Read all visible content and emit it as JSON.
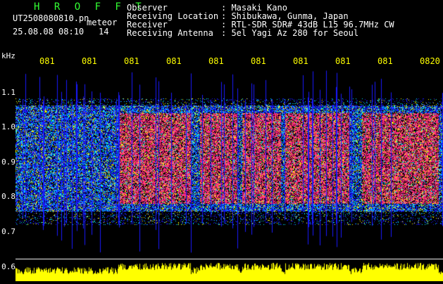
{
  "header": {
    "brand": "H R O F F T",
    "file_name": "UT2508080810.pn",
    "file_suffix": "meteor",
    "datetime": "25.08.08 08:10",
    "count": "14"
  },
  "station": {
    "rows": [
      {
        "label": "Observer",
        "value": ": Masaki Kano"
      },
      {
        "label": "Receiving Location",
        "value": ": Shibukawa, Gunma, Japan"
      },
      {
        "label": "Receiver",
        "value": ": RTL-SDR SDR# 43dB L15 96.7MHz CW"
      },
      {
        "label": "Receiving Antenna",
        "value": ": 5el Yagi Az 280 for Seoul"
      }
    ]
  },
  "spectrogram": {
    "unit": "kHz",
    "y_ticks": [
      "1.1",
      "1.0",
      "0.9",
      "0.8",
      "0.7",
      "0.6"
    ],
    "x_ticks": [
      "081",
      "081",
      "081",
      "081",
      "081",
      "081",
      "081",
      "081",
      "081",
      "0820"
    ],
    "colors": {
      "background": "#000000",
      "low": "#1a1aff",
      "mid": "#00e0ff",
      "high": "#ffff00",
      "peak": "#ff2a80",
      "strength": "#ffff00",
      "label": "#ffff00"
    },
    "bands": [
      {
        "x0": 0.24,
        "x1": 0.41,
        "level": "peak"
      },
      {
        "x0": 0.43,
        "x1": 0.52,
        "level": "peak"
      },
      {
        "x0": 0.53,
        "x1": 0.62,
        "level": "peak"
      },
      {
        "x0": 0.63,
        "x1": 0.78,
        "level": "peak"
      },
      {
        "x0": 0.81,
        "x1": 0.99,
        "level": "peak"
      }
    ]
  }
}
